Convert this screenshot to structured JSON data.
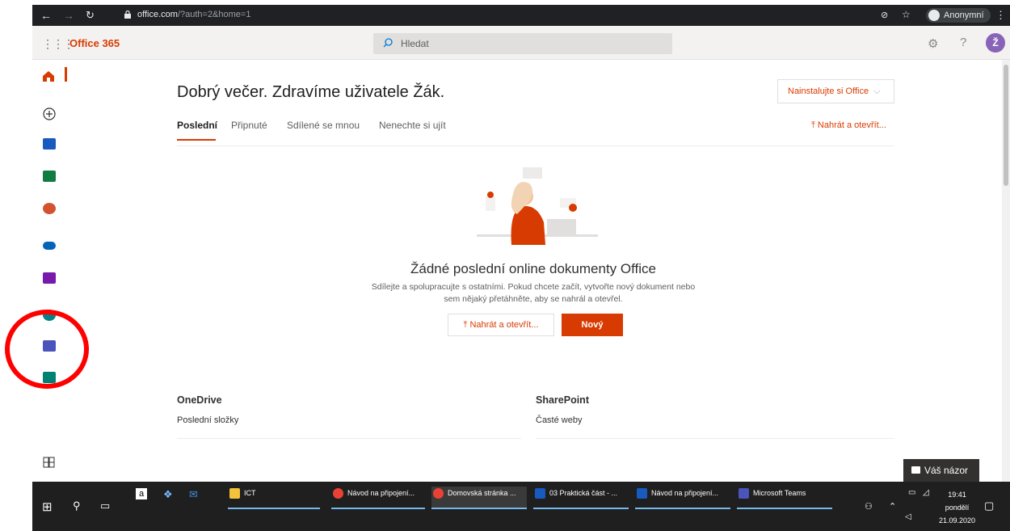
{
  "browser": {
    "url_domain": "office.com",
    "url_rest": "/?auth=2&home=1",
    "profile": "Anonymní"
  },
  "header": {
    "brand": "Office 365",
    "search_placeholder": "Hledat",
    "help": "?",
    "avatar_initial": "Ž"
  },
  "sidebar": {
    "items": [
      "home-icon",
      "create-icon",
      "word-icon",
      "excel-icon",
      "powerpoint-icon",
      "onedrive-icon",
      "onenote-icon",
      "sharepoint-icon",
      "teams-icon",
      "sway-icon",
      "all-apps-icon"
    ]
  },
  "main": {
    "greeting": "Dobrý večer. Zdravíme uživatele Žák.",
    "install_button": "Nainstalujte si Office",
    "tabs": [
      "Poslední",
      "Připnuté",
      "Sdílené se mnou",
      "Nenechte si ujít"
    ],
    "upload_top": "Nahrát a otevřít...",
    "empty_title": "Žádné poslední online dokumenty Office",
    "empty_desc": "Sdílejte a spolupracujte s ostatními. Pokud chcete začít, vytvořte nový dokument nebo sem nějaký přetáhněte, aby se nahrál a otevřel.",
    "upload_button": "Nahrát a otevřít...",
    "new_button": "Nový"
  },
  "sections": {
    "onedrive_title": "OneDrive",
    "onedrive_sub": "Poslední složky",
    "sharepoint_title": "SharePoint",
    "sharepoint_sub": "Časté weby"
  },
  "feedback": "Váš názor",
  "taskbar": {
    "tasks": [
      "ICT",
      "Návod na připojení...",
      "Domovská stránka ...",
      "03 Praktická část - ...",
      "Návod na připojení...",
      "Microsoft Teams"
    ],
    "time": "19:41",
    "day": "pondělí",
    "date": "21.09.2020"
  },
  "colors": {
    "accent": "#d83b01",
    "annotation": "#ff0000"
  }
}
